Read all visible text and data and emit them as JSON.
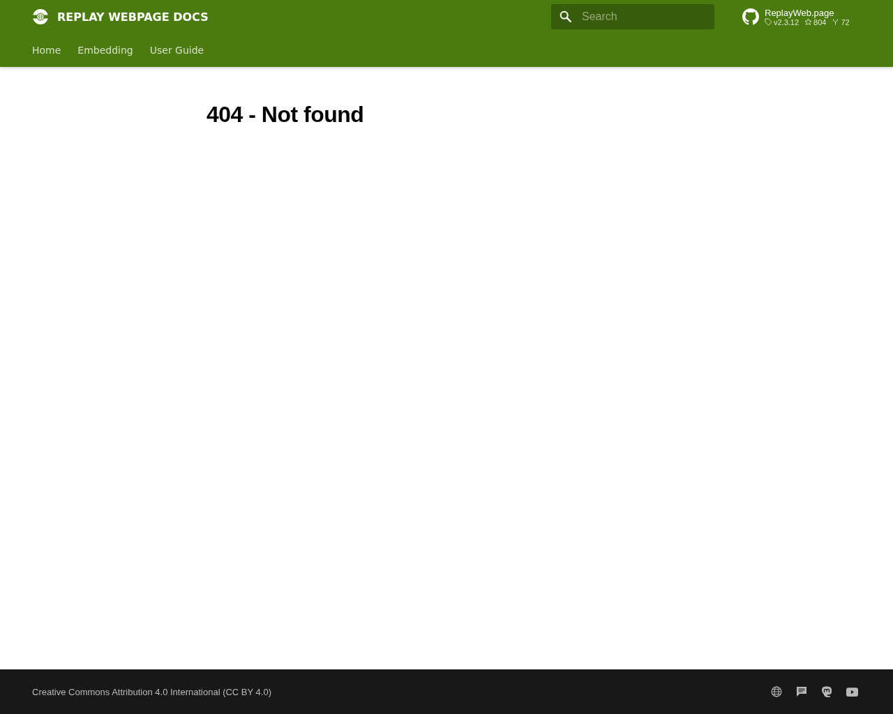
{
  "header": {
    "title": "REPLAY WEBPAGE DOCS",
    "search": {
      "placeholder": "Search"
    },
    "repo": {
      "name": "ReplayWeb.page",
      "version": "v2.3.12",
      "stars": "804",
      "forks": "72"
    }
  },
  "tabs": [
    {
      "label": "Home",
      "selected": false
    },
    {
      "label": "Embedding",
      "selected": false
    },
    {
      "label": "User Guide",
      "selected": false
    }
  ],
  "content": {
    "heading": "404 - Not found"
  },
  "footer": {
    "copyright": "Creative Commons Attribution 4.0 International (CC BY 4.0)",
    "social": [
      {
        "kind": "globe"
      },
      {
        "kind": "chat"
      },
      {
        "kind": "mastodon"
      },
      {
        "kind": "youtube"
      }
    ]
  }
}
